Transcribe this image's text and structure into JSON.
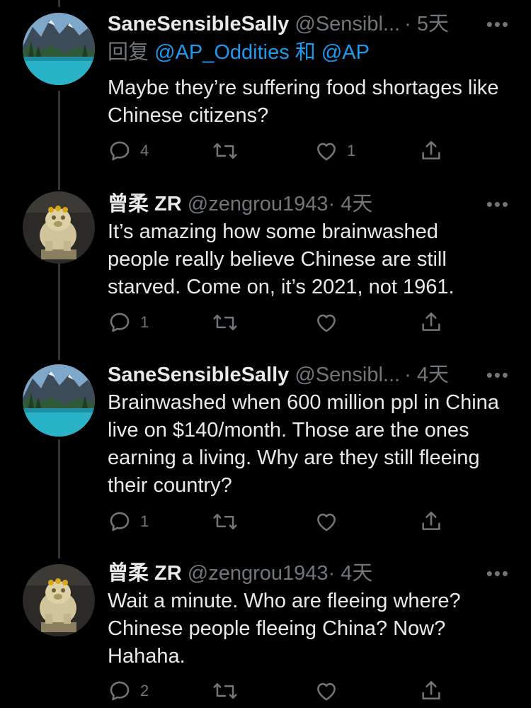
{
  "tweets": [
    {
      "name": "SaneSensibleSally",
      "handle": "@Sensibl...",
      "dot": "·",
      "time": "5天",
      "replying_prefix": "回复",
      "replying_to_1": "@AP_Oddities",
      "replying_and": "和",
      "replying_to_2": "@AP",
      "text": "Maybe they’re suffering food shortages like Chinese citizens?",
      "reply_count": "4",
      "retweet_count": "",
      "like_count": "1",
      "more": "•••",
      "avatar": "lake-landscape"
    },
    {
      "name": "曾柔 ZR",
      "handle": "@zengrou1943",
      "dot": "·",
      "time": "4天",
      "text": "It’s amazing how some brainwashed people really believe Chinese are still starved. Come on, it’s 2021, not 1961.",
      "reply_count": "1",
      "retweet_count": "",
      "like_count": "",
      "more": "•••",
      "avatar": "lion-statue"
    },
    {
      "name": "SaneSensibleSally",
      "handle": "@Sensibl...",
      "dot": "·",
      "time": "4天",
      "text": "Brainwashed when 600 million ppl in China live on $140/month. Those are the ones earning a living. Why are they still fleeing their country?",
      "reply_count": "1",
      "retweet_count": "",
      "like_count": "",
      "more": "•••",
      "avatar": "lake-landscape"
    },
    {
      "name": "曾柔 ZR",
      "handle": "@zengrou1943",
      "dot": "·",
      "time": "4天",
      "text": "Wait a minute. Who are fleeing where? Chinese people fleeing China? Now? Hahaha.",
      "reply_count": "2",
      "retweet_count": "",
      "like_count": "",
      "more": "•••",
      "avatar": "lion-statue"
    }
  ],
  "colors": {
    "background": "#000000",
    "text": "#e7e9ea",
    "muted": "#71767b",
    "link": "#1d9bf0",
    "thread_line": "#333639"
  }
}
